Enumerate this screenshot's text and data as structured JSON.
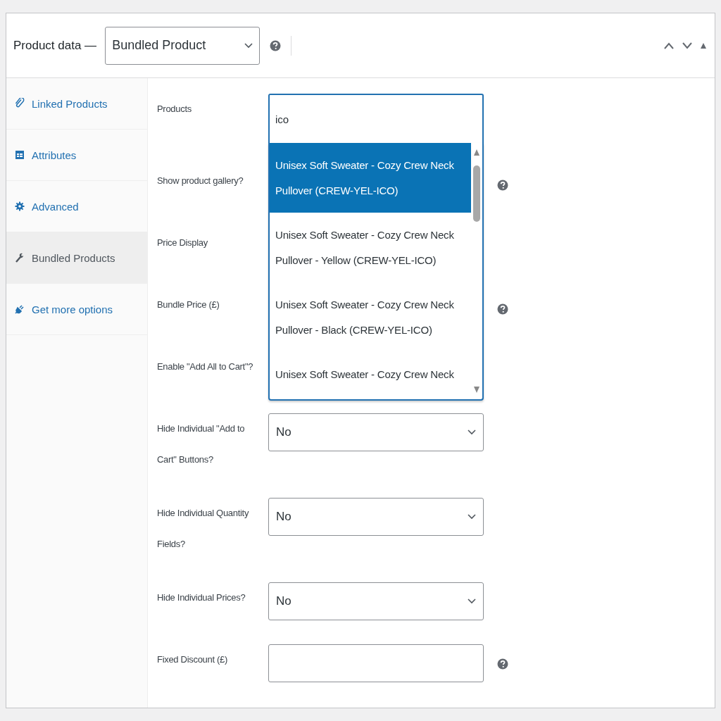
{
  "header": {
    "title": "Product data —",
    "product_type": "Bundled Product",
    "help": true
  },
  "tabs": [
    {
      "label": "Linked Products",
      "selected": false
    },
    {
      "label": "Attributes",
      "selected": false
    },
    {
      "label": "Advanced",
      "selected": false
    },
    {
      "label": "Bundled Products",
      "selected": true
    },
    {
      "label": "Get more options",
      "selected": false
    }
  ],
  "fields": [
    {
      "kind": "search",
      "label": "Products",
      "value": "ico",
      "help": false,
      "options": [
        {
          "text": "Unisex Soft Sweater - Cozy Crew Neck Pullover (CREW-YEL-ICO)",
          "selected": true
        },
        {
          "text": "Unisex Soft Sweater - Cozy Crew Neck Pullover - Yellow (CREW-YEL-ICO)",
          "selected": false
        },
        {
          "text": "Unisex Soft Sweater - Cozy Crew Neck Pullover - Black (CREW-YEL-ICO)",
          "selected": false
        },
        {
          "text": "Unisex Soft Sweater - Cozy Crew Neck",
          "selected": false
        }
      ]
    },
    {
      "kind": "covered",
      "label": "Show product gallery?",
      "help": true
    },
    {
      "kind": "covered",
      "label": "Price Display",
      "help": false
    },
    {
      "kind": "covered",
      "label": "Bundle Price (£)",
      "help": true
    },
    {
      "kind": "covered",
      "label": "Enable \"Add All to Cart\"?",
      "help": false
    },
    {
      "kind": "select",
      "label": "Hide Individual \"Add to Cart\" Buttons?",
      "value": "No",
      "help": false
    },
    {
      "kind": "select",
      "label": "Hide Individual Quantity Fields?",
      "value": "No",
      "help": false
    },
    {
      "kind": "select",
      "label": "Hide Individual Prices?",
      "value": "No",
      "help": false
    },
    {
      "kind": "input",
      "label": "Fixed Discount (£)",
      "help": true
    }
  ]
}
